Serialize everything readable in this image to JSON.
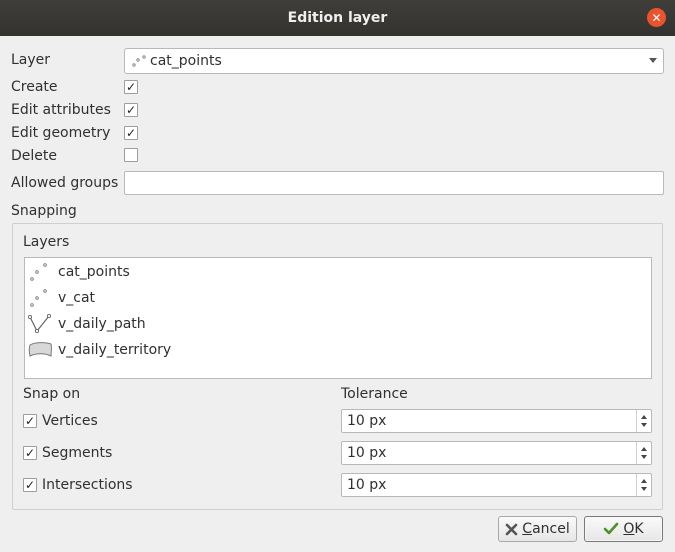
{
  "window": {
    "title": "Edition layer",
    "close_symbol": "✕"
  },
  "layer": {
    "label": "Layer",
    "selected": "cat_points"
  },
  "permissions": [
    {
      "label": "Create",
      "checked": true
    },
    {
      "label": "Edit attributes",
      "checked": true
    },
    {
      "label": "Edit geometry",
      "checked": true
    },
    {
      "label": "Delete",
      "checked": false
    }
  ],
  "allowed_groups": {
    "label": "Allowed groups",
    "value": ""
  },
  "snapping": {
    "title": "Snapping",
    "layers_label": "Layers",
    "layers": [
      {
        "name": "cat_points",
        "icon": "point-layer-icon"
      },
      {
        "name": "v_cat",
        "icon": "point-layer-icon"
      },
      {
        "name": "v_daily_path",
        "icon": "line-layer-icon"
      },
      {
        "name": "v_daily_territory",
        "icon": "polygon-layer-icon"
      }
    ],
    "snap_on_label": "Snap on",
    "tolerance_label": "Tolerance",
    "options": [
      {
        "label": "Vertices",
        "checked": true,
        "tolerance": "10 px"
      },
      {
        "label": "Segments",
        "checked": true,
        "tolerance": "10 px"
      },
      {
        "label": "Intersections",
        "checked": true,
        "tolerance": "10 px"
      }
    ]
  },
  "buttons": {
    "cancel": {
      "underlined": "C",
      "rest": "ancel"
    },
    "ok": {
      "underlined": "O",
      "rest": "K"
    }
  },
  "colors": {
    "titlebar": "#3a3936",
    "close": "#e9542f",
    "check": "#2e7d32"
  }
}
